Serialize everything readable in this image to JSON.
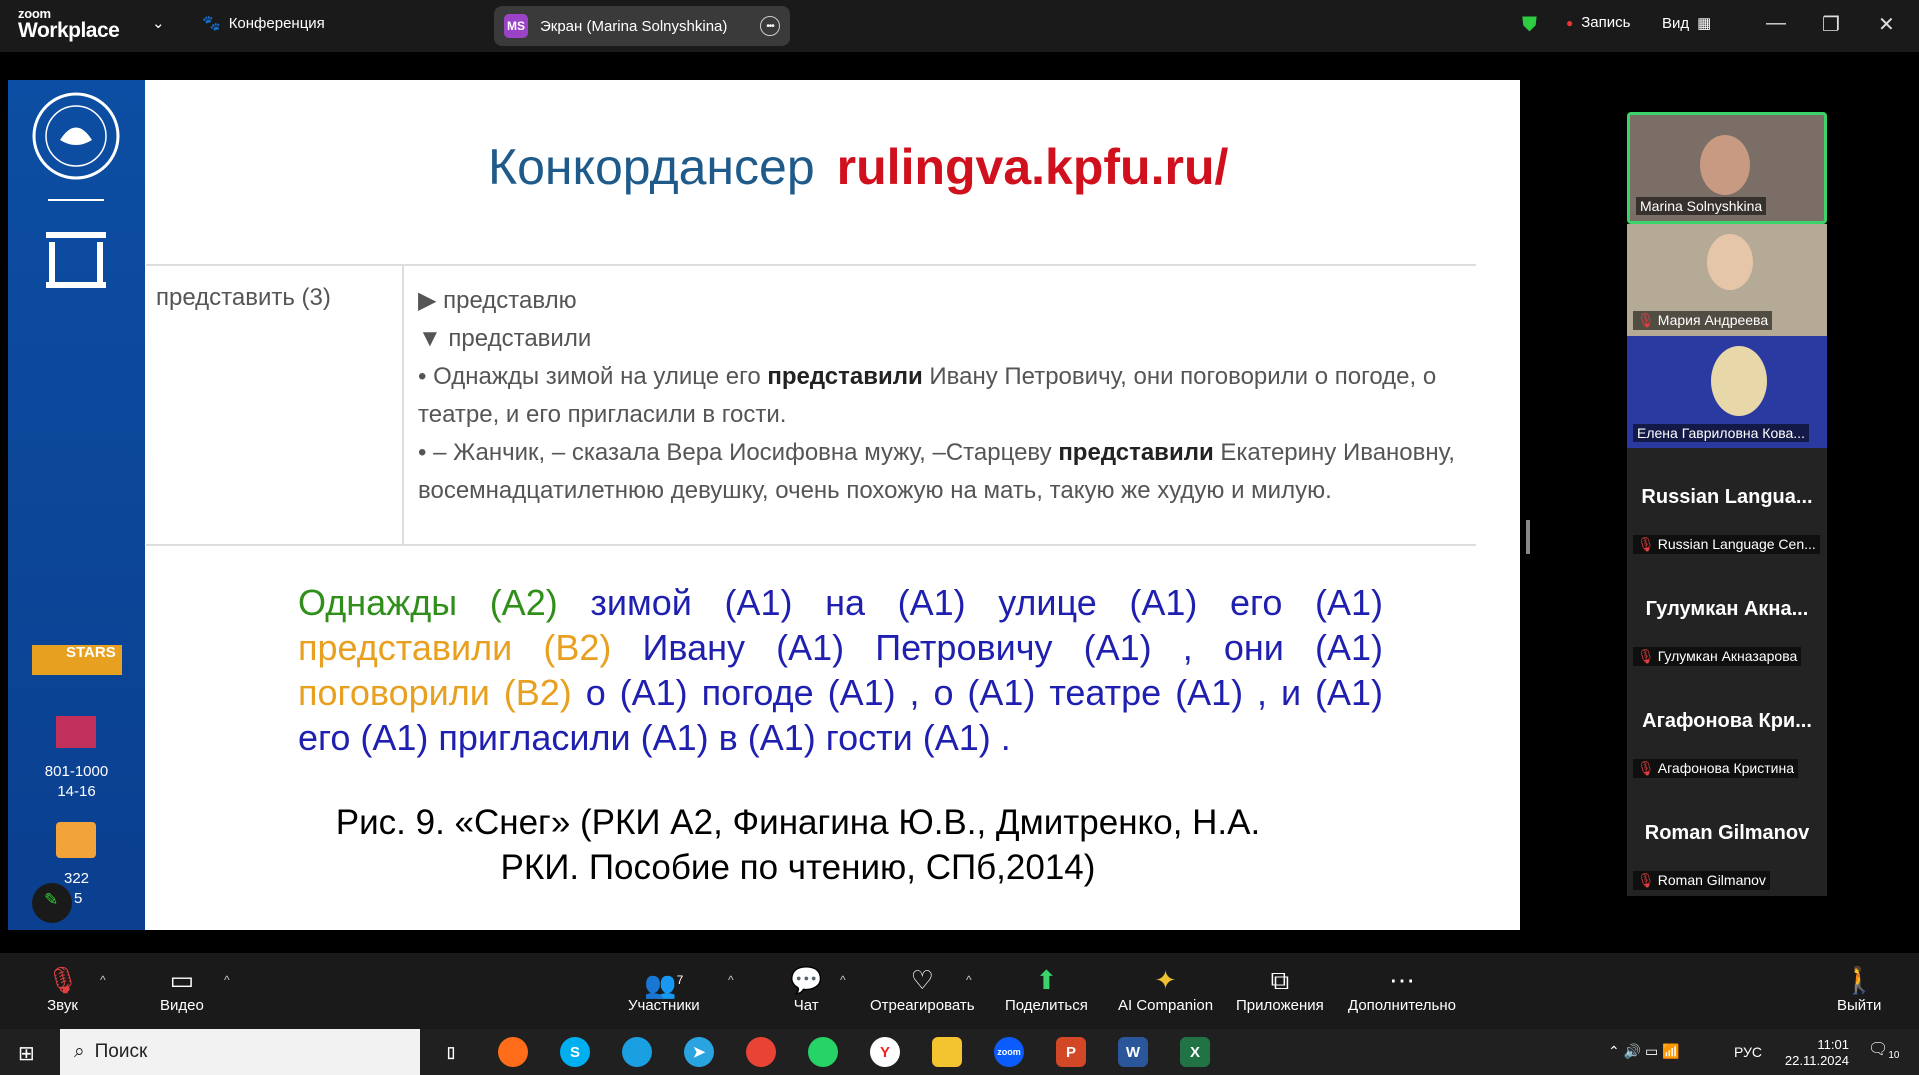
{
  "app": {
    "logo_small": "zoom",
    "logo_big": "Workplace",
    "meeting_menu": "Конференция",
    "screen_label": "Экран (Marina Solnyshkina)",
    "screen_badge": "MS",
    "record_label": "Запись",
    "view_label": "Вид"
  },
  "slide": {
    "title": "Конкордансер",
    "url": "rulingva.kpfu.ru/",
    "lemma": "представить (3)",
    "forms": [
      "▶ представлю",
      "▼ представили"
    ],
    "ex1_a": "• Однажды зимой на улице его ",
    "ex1_b": "представили",
    "ex1_c": " Ивану Петровичу, они поговорили о погоде, о театре, и его пригласили в гости.",
    "ex2_a": "• – Жанчик, – сказала Вера Иосифовна мужу, –Старцеву ",
    "ex2_b": "представили",
    "ex2_c": " Екатерину Ивановну, восемнадцатилетнюю девушку, очень похожую на мать, такую же худую и милую.",
    "side_rank1": "801-1000",
    "side_rank2": "14-16",
    "side_rank3": "322",
    "side_rank4": "5",
    "stars": "STARS",
    "caption": "Рис. 9. «Снег» (РКИ А2, Финагина Ю.В., Дмитренко, Н.А. РКИ. Пособие по чтению, СПб,2014)"
  },
  "participants": [
    {
      "name": "Marina Solnyshkina",
      "big": ""
    },
    {
      "name": "Мария Андреева",
      "big": ""
    },
    {
      "name": "Елена Гавриловна Кова...",
      "big": ""
    },
    {
      "name": "Russian Language Cen...",
      "big": "Russian Langua..."
    },
    {
      "name": "Гулумкан Акназарова",
      "big": "Гулумкан Акна..."
    },
    {
      "name": "Агафонова Кристина",
      "big": "Агафонова Кри..."
    },
    {
      "name": "Roman Gilmanov",
      "big": "Roman Gilmanov"
    }
  ],
  "toolbar": {
    "mute": "Звук",
    "video": "Видео",
    "participants": "Участники",
    "participants_count": "7",
    "chat": "Чат",
    "react": "Отреагировать",
    "share": "Поделиться",
    "ai": "AI Companion",
    "apps": "Приложения",
    "more": "Дополнительно",
    "leave": "Выйти"
  },
  "taskbar": {
    "search": "Поиск",
    "lang": "РУС",
    "time": "11:01",
    "date": "22.11.2024",
    "notif": "10"
  }
}
